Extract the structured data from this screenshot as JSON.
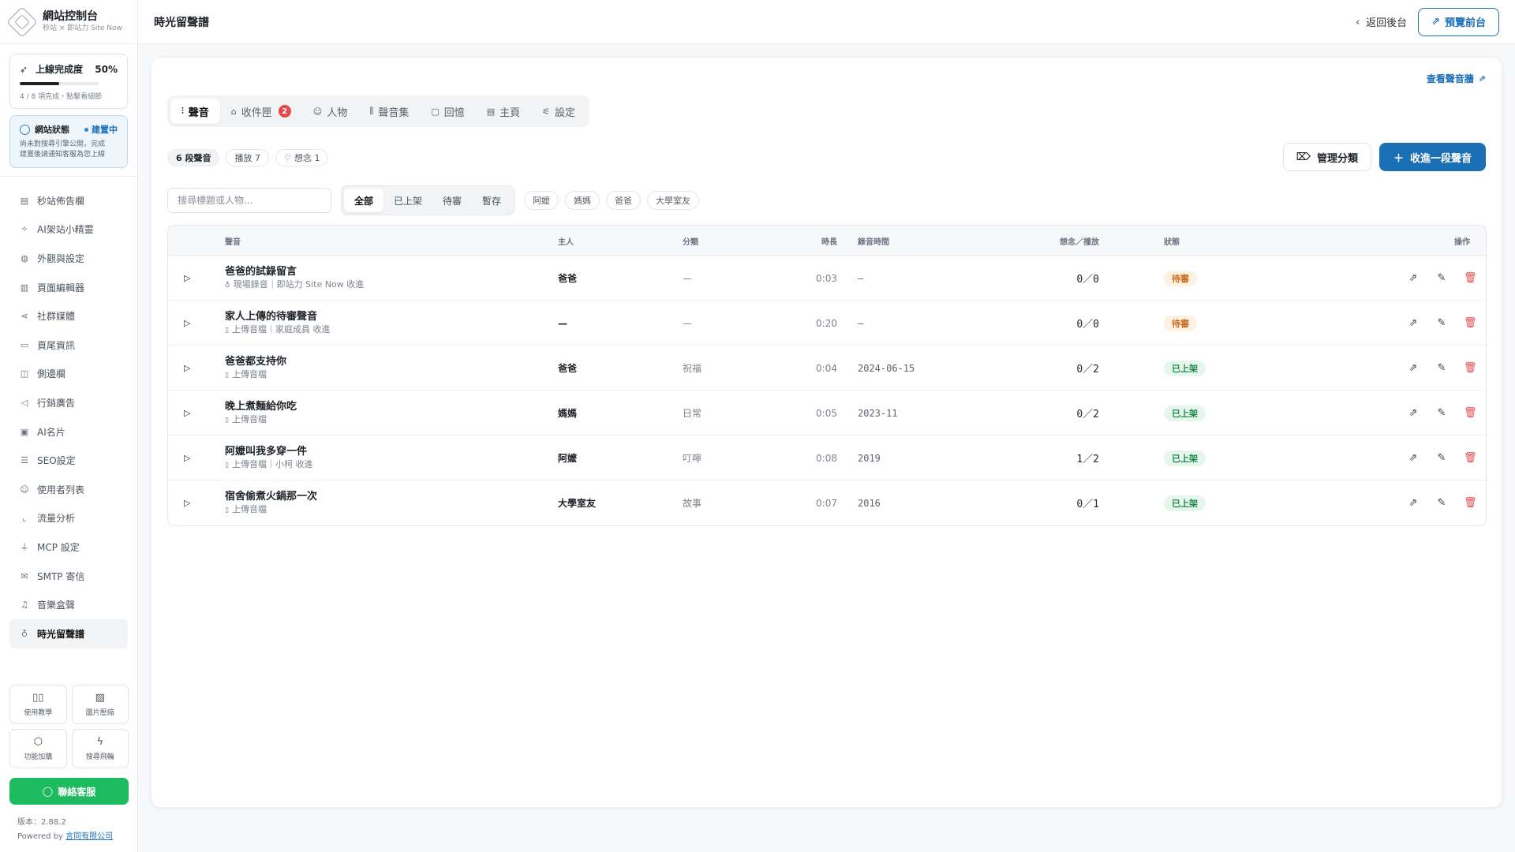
{
  "brand": {
    "title": "網站控制台",
    "subtitle": "秒站 × 即站力 Site Now"
  },
  "launch": {
    "label": "上線完成度",
    "percent_label": "50%",
    "progress": 0.5,
    "note": "4 / 8 項完成・點擊看細節"
  },
  "site_status": {
    "label": "網站狀態",
    "badge": "建置中",
    "note_line1": "尚未對搜尋引擎公開，完成",
    "note_line2": "建置後請通知客服為您上線"
  },
  "nav": [
    {
      "label": "秒站佈告欄",
      "icon": "newspaper-icon",
      "glyph": "▤"
    },
    {
      "label": "AI架站小精靈",
      "icon": "sparkle-icon",
      "glyph": "✧"
    },
    {
      "label": "外觀與設定",
      "icon": "palette-icon",
      "glyph": "◍"
    },
    {
      "label": "頁面編輯器",
      "icon": "layout-icon",
      "glyph": "▥"
    },
    {
      "label": "社群媒體",
      "icon": "share-icon",
      "glyph": "⋖"
    },
    {
      "label": "頁尾資訊",
      "icon": "card-icon",
      "glyph": "▭"
    },
    {
      "label": "側邊欄",
      "icon": "sidebar-icon",
      "glyph": "◫"
    },
    {
      "label": "行銷廣告",
      "icon": "megaphone-icon",
      "glyph": "◁"
    },
    {
      "label": "AI名片",
      "icon": "id-card-icon",
      "glyph": "▣"
    },
    {
      "label": "SEO設定",
      "icon": "database-icon",
      "glyph": "☰"
    },
    {
      "label": "使用者列表",
      "icon": "users-icon",
      "glyph": "☺"
    },
    {
      "label": "流量分析",
      "icon": "chart-icon",
      "glyph": "⌞"
    },
    {
      "label": "MCP 設定",
      "icon": "plug-icon",
      "glyph": "⏚"
    },
    {
      "label": "SMTP 寄信",
      "icon": "mail-icon",
      "glyph": "✉"
    },
    {
      "label": "音樂盒聲",
      "icon": "music-icon",
      "glyph": "♫"
    },
    {
      "label": "時光留聲譜",
      "icon": "mic-icon",
      "glyph": "♁",
      "active": true
    }
  ],
  "tools": [
    {
      "label": "使用教學",
      "icon": "book-icon",
      "glyph": "▯▯"
    },
    {
      "label": "圖片壓縮",
      "icon": "image-icon",
      "glyph": "▨"
    },
    {
      "label": "功能加購",
      "icon": "package-icon",
      "glyph": "⬡"
    },
    {
      "label": "搜尋飛輪",
      "icon": "bolt-icon",
      "glyph": "ϟ"
    }
  ],
  "contact_label": "聯絡客服",
  "version": {
    "text": "版本：2.88.2",
    "powered": "Powered by",
    "company": "言同有限公司"
  },
  "topbar": {
    "title": "時光留聲譜",
    "back": "返回後台",
    "preview": "預覽前台"
  },
  "view_wall": "查看聲音牆",
  "tabs": [
    {
      "label": "聲音",
      "icon": "waveform-icon",
      "glyph": "⫶",
      "active": true
    },
    {
      "label": "收件匣",
      "icon": "inbox-icon",
      "glyph": "⌂",
      "badge": "2"
    },
    {
      "label": "人物",
      "icon": "people-icon",
      "glyph": "☺"
    },
    {
      "label": "聲音集",
      "icon": "library-icon",
      "glyph": "⫼"
    },
    {
      "label": "回憶",
      "icon": "message-icon",
      "glyph": "▢"
    },
    {
      "label": "主頁",
      "icon": "home-layout-icon",
      "glyph": "▤"
    },
    {
      "label": "設定",
      "icon": "sliders-icon",
      "glyph": "⚟"
    }
  ],
  "stats": {
    "count": "6 段聲音",
    "plays": "播放 7",
    "likes": "想念 1"
  },
  "buttons": {
    "manage": "管理分類",
    "collect": "收進一段聲音"
  },
  "search": {
    "placeholder": "搜尋標題或人物..."
  },
  "status_filters": [
    {
      "label": "全部",
      "active": true
    },
    {
      "label": "已上架"
    },
    {
      "label": "待審"
    },
    {
      "label": "暫存"
    }
  ],
  "people_filters": [
    "阿嬤",
    "媽媽",
    "爸爸",
    "大學室友"
  ],
  "table": {
    "headers": {
      "voice": "聲音",
      "owner": "主人",
      "category": "分類",
      "duration": "時長",
      "recorded": "錄音時間",
      "counts": "想念／播放",
      "status": "狀態",
      "ops": "操作"
    },
    "rows": [
      {
        "title": "爸爸的試錄留言",
        "sub_icon": "mic-icon",
        "sub_glyph": "♁",
        "sub": "現場錄音｜即站力 Site Now 收進",
        "owner": "爸爸",
        "category": "—",
        "duration": "0:03",
        "recorded": "—",
        "counts": "0／0",
        "status": "待審",
        "status_kind": "pending"
      },
      {
        "title": "家人上傳的待審聲音",
        "sub_icon": "file-audio-icon",
        "sub_glyph": "▯",
        "sub": "上傳音檔｜家庭成員 收進",
        "owner": "—",
        "category": "—",
        "duration": "0:20",
        "recorded": "—",
        "counts": "0／0",
        "status": "待審",
        "status_kind": "pending"
      },
      {
        "title": "爸爸都支持你",
        "sub_icon": "file-audio-icon",
        "sub_glyph": "▯",
        "sub": "上傳音檔",
        "owner": "爸爸",
        "category": "祝福",
        "duration": "0:04",
        "recorded": "2024-06-15",
        "counts": "0／2",
        "status": "已上架",
        "status_kind": "live"
      },
      {
        "title": "晚上煮麵給你吃",
        "sub_icon": "file-audio-icon",
        "sub_glyph": "▯",
        "sub": "上傳音檔",
        "owner": "媽媽",
        "category": "日常",
        "duration": "0:05",
        "recorded": "2023-11",
        "counts": "0／2",
        "status": "已上架",
        "status_kind": "live"
      },
      {
        "title": "阿嬤叫我多穿一件",
        "sub_icon": "file-audio-icon",
        "sub_glyph": "▯",
        "sub": "上傳音檔｜小柯 收進",
        "owner": "阿嬤",
        "category": "叮嚀",
        "duration": "0:08",
        "recorded": "2019",
        "counts": "1／2",
        "status": "已上架",
        "status_kind": "live"
      },
      {
        "title": "宿舍偷煮火鍋那一次",
        "sub_icon": "file-audio-icon",
        "sub_glyph": "▯",
        "sub": "上傳音檔",
        "owner": "大學室友",
        "category": "故事",
        "duration": "0:07",
        "recorded": "2016",
        "counts": "0／1",
        "status": "已上架",
        "status_kind": "live"
      }
    ]
  },
  "colors": {
    "primary": "#1b6fb5",
    "contact": "#1dbb5f",
    "pending_bg": "#fdf1e4",
    "pending_fg": "#c86a1a",
    "live_bg": "#e6f6ec",
    "live_fg": "#1f8a4c",
    "danger": "#e5484d"
  }
}
